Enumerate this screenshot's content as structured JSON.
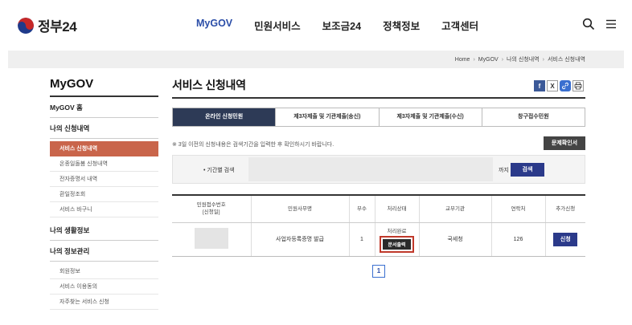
{
  "header": {
    "logo_text": "정부24",
    "nav": [
      "MyGOV",
      "민원서비스",
      "보조금24",
      "정책정보",
      "고객센터"
    ],
    "active_nav": "MyGOV",
    "icons": [
      "search-icon",
      "menu-icon"
    ]
  },
  "breadcrumb": [
    "Home",
    "MyGOV",
    "나의 신청내역",
    "서비스 신청내역"
  ],
  "sidebar": {
    "title": "MyGOV",
    "home": "MyGOV 홈",
    "section1": "나의 신청내역",
    "section1_items": [
      "서비스 신청내역",
      "온종일돌봄 신청내역",
      "전자증명서 내역",
      "환일정조회",
      "서비스 바구니"
    ],
    "section2": "나의 생활정보",
    "section3": "나의 정보관리",
    "section3_items": [
      "회원정보",
      "서비스 이용동의",
      "자주찾는 서비스 신청"
    ]
  },
  "main": {
    "title": "서비스 신청내역",
    "share_icons": [
      "facebook-icon",
      "x-icon",
      "link-icon",
      "print-icon"
    ],
    "tabs": [
      "온라인 신청민원",
      "제3자제출 및 기관제출(송신)",
      "제3자제출 및 기관제출(수신)",
      "창구접수민원"
    ],
    "notice": "※ 3일 이전의 신청내용은 검색기간을 입력한 후 확인하시기 바랍니다.",
    "password_button": "문제확인서",
    "search_label": "• 기간별 검색",
    "search_tilde": "까지",
    "search_button": "검색",
    "table": {
      "headers": [
        "민원접수번호\n[신청일]",
        "민원사무명",
        "부수",
        "처리상태",
        "교부기관",
        "연락처",
        "추가신청"
      ],
      "rows": [
        {
          "service": "사업자등록증명 발급",
          "copies": "1",
          "status": "처리완료",
          "doc_button": "문서출력",
          "agency": "국세청",
          "contact": "126",
          "apply_button": "신청"
        }
      ]
    },
    "pagination": [
      "1"
    ]
  },
  "colors": {
    "accent_nav": "#2b4ea8",
    "sidebar_active": "#c9654b",
    "tab_active": "#2d3a56",
    "button_primary": "#2b3a8a",
    "highlight_border": "#c0392b"
  }
}
